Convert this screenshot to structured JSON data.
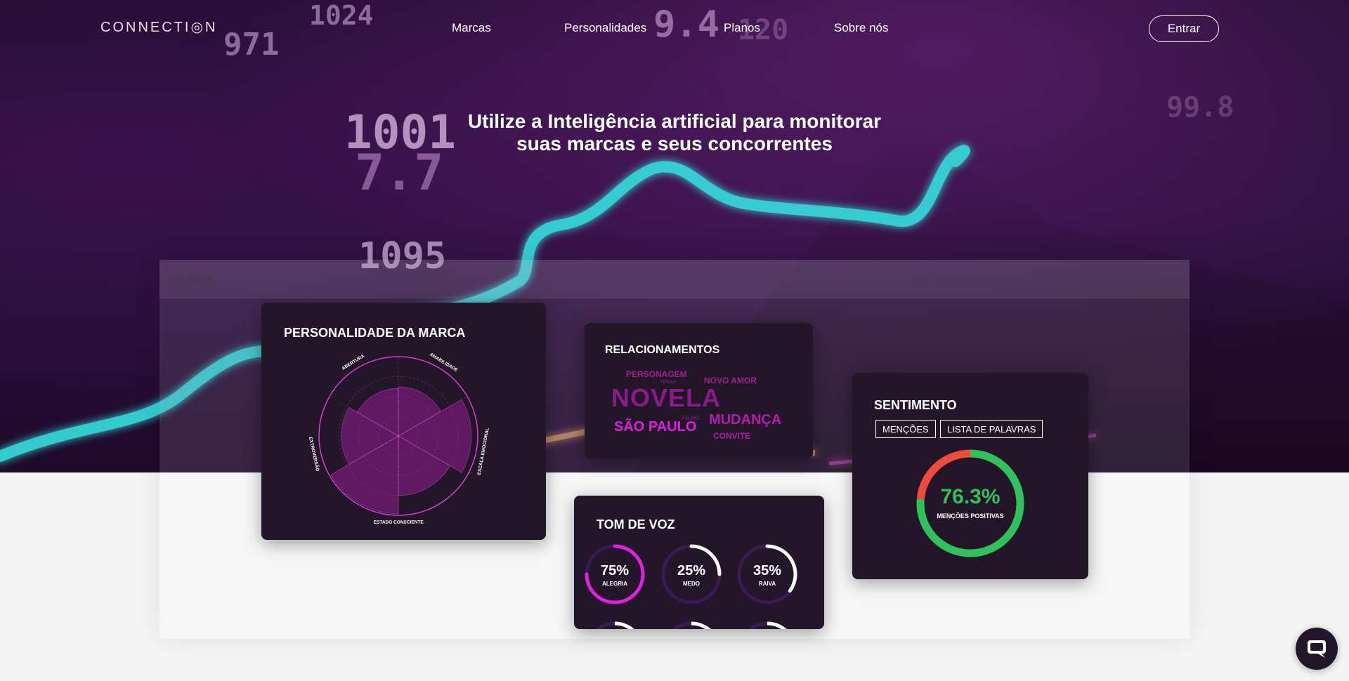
{
  "brand": {
    "logo_text": "CONNECTI◎N"
  },
  "nav": {
    "items": [
      {
        "label": "Marcas"
      },
      {
        "label": "Personalidades"
      },
      {
        "label": "Planos"
      },
      {
        "label": "Sobre nós"
      }
    ],
    "login_label": "Entrar"
  },
  "hero": {
    "headline_line1": "Utilize a Inteligência artificial para monitorar",
    "headline_line2": "suas marcas e seus concorrentes",
    "background_numbers": [
      "971",
      "1024",
      "9.4",
      "120",
      "1001",
      "7.7",
      "1095",
      "99.8"
    ]
  },
  "personality_card": {
    "title": "PERSONALIDADE DA MARCA",
    "axes": [
      "ABERTURA",
      "AMABILIDADE",
      "ESCALA EMOCIONAL",
      "ESTADO CONSCIENTE",
      "EXTROVERSÃO"
    ],
    "values": [
      0.62,
      0.92,
      0.75,
      0.98,
      0.72,
      0.6
    ],
    "color": "#d63fd6"
  },
  "relationships_card": {
    "title": "RELACIONAMENTOS",
    "words": [
      {
        "text": "PERSONAGEM",
        "color": "#a0208f"
      },
      {
        "text": "NOVO AMOR",
        "color": "#a0208f"
      },
      {
        "text": "FÉRIAS",
        "color": "#7a1a72"
      },
      {
        "text": "NOVELA",
        "color": "#8a1a8a"
      },
      {
        "text": "FILHO",
        "color": "#7a1a72"
      },
      {
        "text": "SÃO PAULO",
        "color": "#e020e0"
      },
      {
        "text": "MUDANÇA",
        "color": "#b020a8"
      },
      {
        "text": "CONVITE",
        "color": "#b020a8"
      }
    ]
  },
  "sentiment_card": {
    "title": "SENTIMENTO",
    "tabs": [
      "MENÇÕES",
      "LISTA DE PALAVRAS"
    ],
    "value_text": "76.3%",
    "value": 0.763,
    "caption": "MENÇÕES POSITIVAS",
    "positive_color": "#2fc25b",
    "negative_color": "#f04a3c"
  },
  "tone_card": {
    "title": "TOM DE VOZ",
    "gauges": [
      {
        "value_text": "75%",
        "value": 0.75,
        "label": "ALEGRIA",
        "color": "#e020e0"
      },
      {
        "value_text": "25%",
        "value": 0.25,
        "label": "MEDO",
        "color": "#ffffff"
      },
      {
        "value_text": "35%",
        "value": 0.35,
        "label": "RAIVA",
        "color": "#ffffff"
      }
    ]
  },
  "colors": {
    "hero_bg": "#200a2c",
    "card_bg": "#231628",
    "accent": "#e020e0",
    "trend_line": "#35e0e0"
  },
  "chat": {
    "icon": "chat-bubble-icon"
  }
}
